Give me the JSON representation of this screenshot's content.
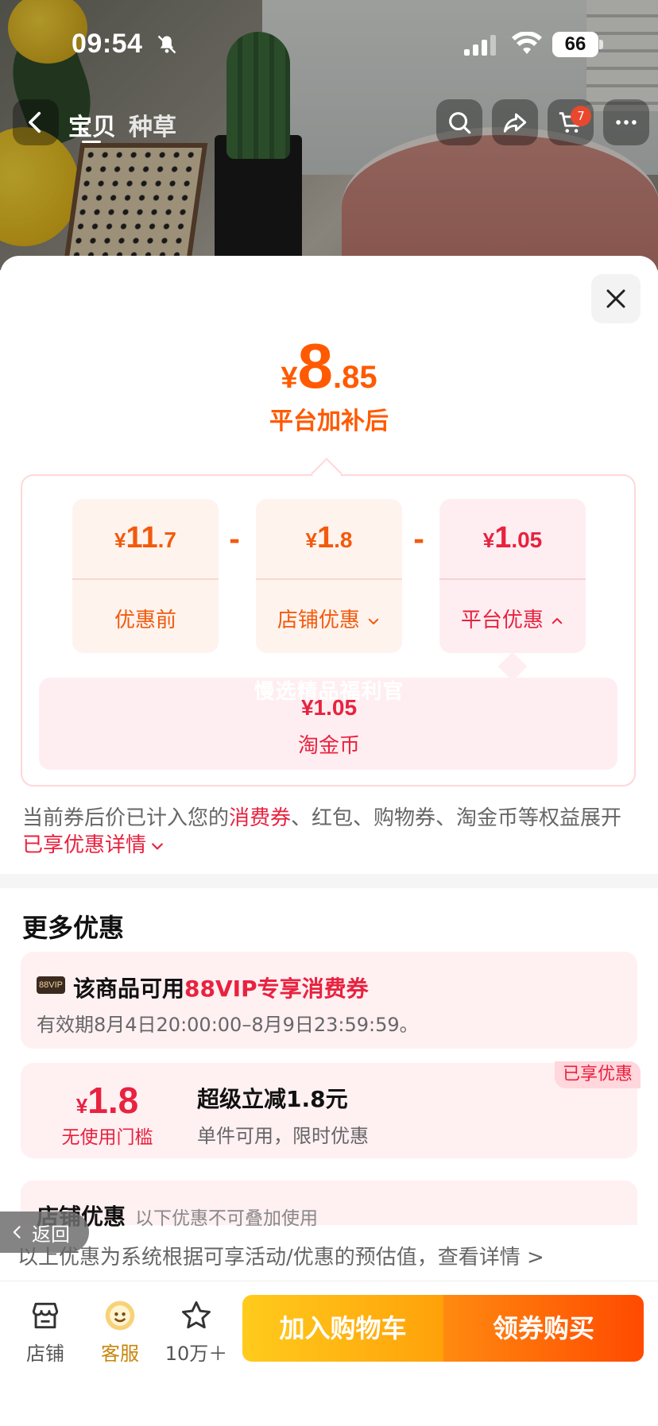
{
  "status_bar": {
    "time": "09:54",
    "battery": "66"
  },
  "nav": {
    "tabs": [
      "宝贝",
      "种草"
    ],
    "cart_badge": "7"
  },
  "price": {
    "symbol": "¥",
    "integer": "8",
    "decimal": ".85",
    "label": "平台加补后"
  },
  "breakdown": {
    "cards": [
      {
        "symbol": "¥",
        "integer": "11",
        "decimal": ".7",
        "label": "优惠前"
      },
      {
        "symbol": "¥",
        "integer": "1",
        "decimal": ".8",
        "label": "店铺优惠"
      },
      {
        "symbol": "¥",
        "integer": "1",
        "decimal": ".05",
        "label": "平台优惠"
      }
    ],
    "operator": "-",
    "coin": {
      "watermark": "慢选精品福利官",
      "value": "¥1.05",
      "label": "淘金币"
    }
  },
  "note": {
    "part1": "当前券后价已计入您的",
    "link1": "消费券",
    "part2": "、红包、购物券、淘金币等权益展开",
    "link2": "已享优惠详情"
  },
  "more": {
    "title": "更多优惠",
    "vip": {
      "tag": "88VIP",
      "title_prefix": "该商品可用",
      "title_highlight": "88VIP专享消费券",
      "validity": "有效期8月4日20:00:00–8月9日23:59:59。"
    },
    "coupon": {
      "badge": "已享优惠",
      "symbol": "¥",
      "amount": "1.8",
      "condition": "无使用门槛",
      "title": "超级立减1.8元",
      "subtitle": "单件可用，限时优惠"
    },
    "shop": {
      "title": "店铺优惠",
      "subtitle": "以下优惠不可叠加使用"
    }
  },
  "back_label": "返回",
  "disclaimer": "以上优惠为系统根据可享活动/优惠的预估值，查看详情 >",
  "bottom": {
    "tools": [
      {
        "label": "店铺",
        "icon": "store-icon"
      },
      {
        "label": "客服",
        "icon": "customer-service-icon"
      },
      {
        "label": "10万＋",
        "icon": "star-icon"
      }
    ],
    "add_to_cart": "加入购物车",
    "buy_now": "领券购买"
  },
  "colors": {
    "primary_orange": "#ff5a00",
    "platform_red": "#e8223f",
    "cart_yellow": "#ffcb1c",
    "buy_orange": "#ff4a00"
  }
}
